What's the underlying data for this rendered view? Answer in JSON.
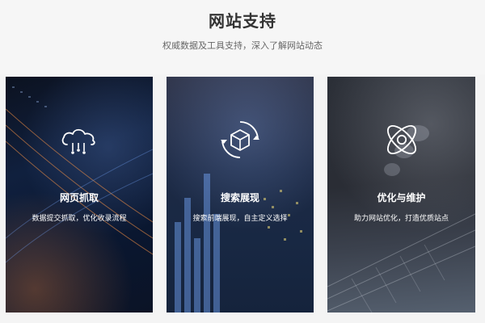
{
  "header": {
    "title": "网站支持",
    "subtitle": "权威数据及工具支持，深入了解网站动态"
  },
  "cards": [
    {
      "title": "网页抓取",
      "description": "数据提交抓取，优化收录流程",
      "icon": "cloud-icon"
    },
    {
      "title": "搜索展现",
      "description": "搜索前端展现，自主定义选择",
      "icon": "cube-icon"
    },
    {
      "title": "优化与维护",
      "description": "助力网站优化，打造优质站点",
      "icon": "atom-icon"
    }
  ],
  "colors": {
    "page_background": "#f4f4f4",
    "title_text": "#333333",
    "subtitle_text": "#666666",
    "card_text": "#ffffff"
  }
}
